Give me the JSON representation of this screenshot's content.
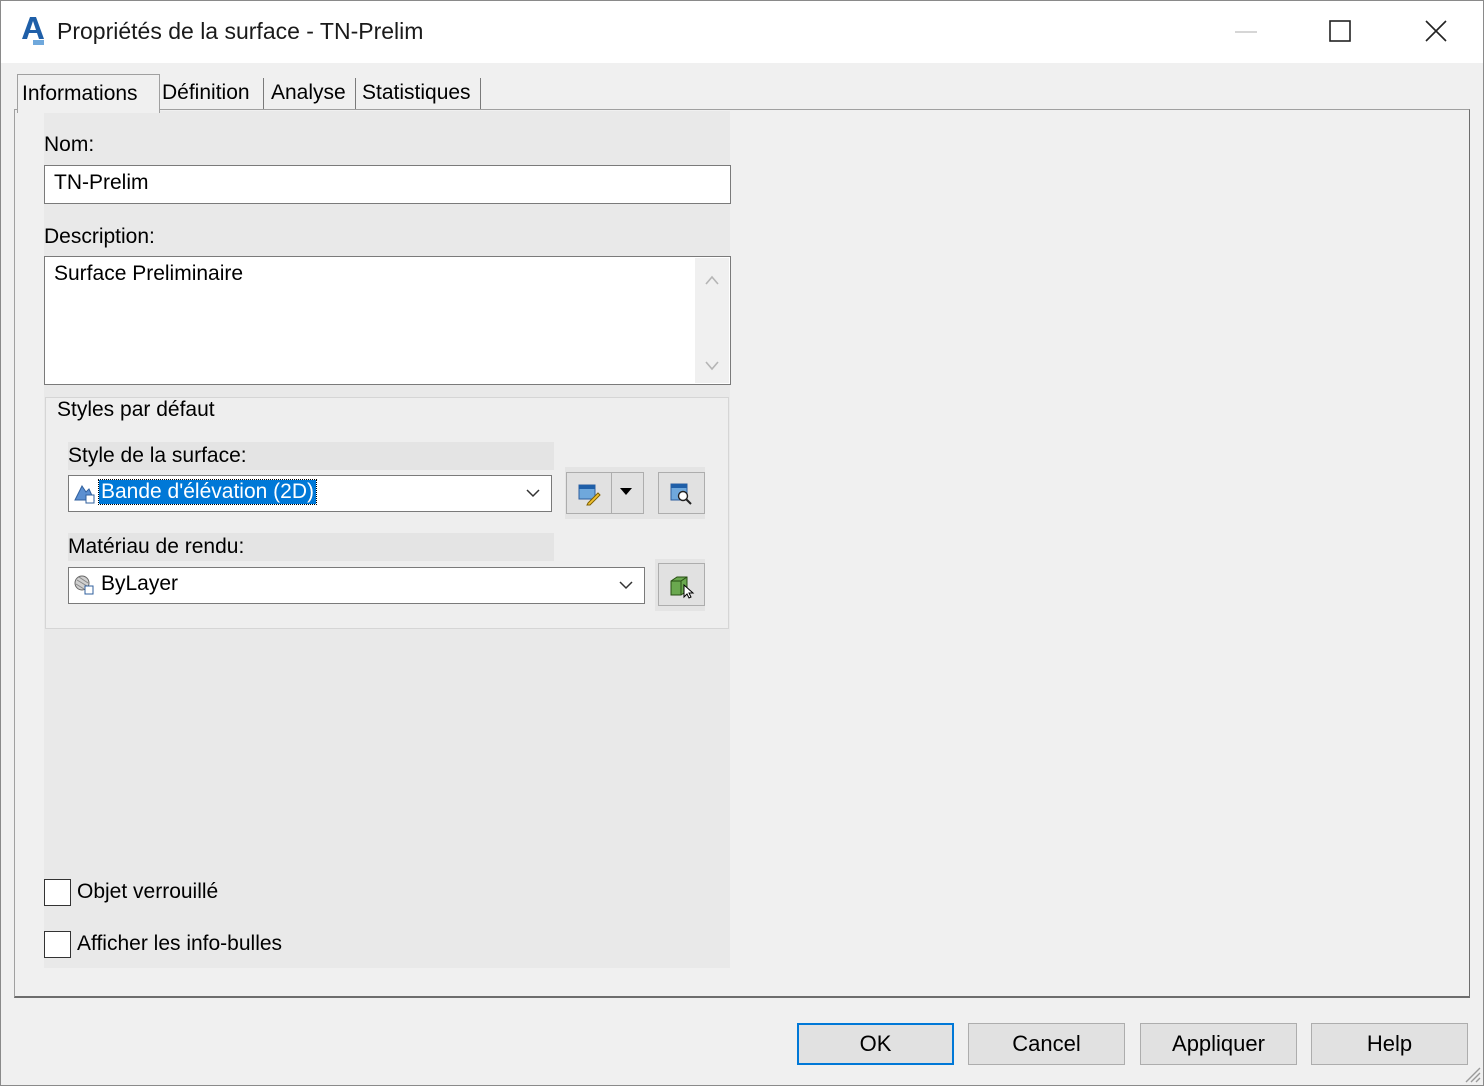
{
  "window": {
    "title": "Propriétés de la surface - TN-Prelim",
    "app_icon": "autocad-civil-icon"
  },
  "tabs": [
    {
      "label": "Informations",
      "active": true
    },
    {
      "label": "Définition",
      "active": false
    },
    {
      "label": "Analyse",
      "active": false
    },
    {
      "label": "Statistiques",
      "active": false
    }
  ],
  "info": {
    "name_label": "Nom:",
    "name_value": "TN-Prelim",
    "description_label": "Description:",
    "description_value": "Surface Preliminaire",
    "styles_group_label": "Styles par défaut",
    "surface_style_label": "Style de la surface:",
    "surface_style_value": "Bande d'élévation (2D)",
    "render_material_label": "Matériau de rendu:",
    "render_material_value": "ByLayer",
    "locked_label": "Objet verrouillé",
    "locked_checked": false,
    "tooltips_label": "Afficher les info-bulles",
    "tooltips_checked": false
  },
  "buttons": {
    "ok": "OK",
    "cancel": "Cancel",
    "apply": "Appliquer",
    "help": "Help"
  },
  "colors": {
    "selection": "#0078d7",
    "dialog_bg": "#f0f0f0"
  }
}
